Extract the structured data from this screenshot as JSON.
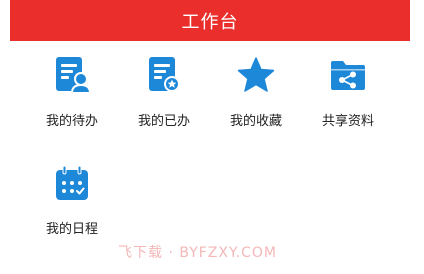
{
  "header": {
    "title": "工作台"
  },
  "tiles": [
    {
      "label": "我的待办",
      "icon": "pending-doc-user-icon"
    },
    {
      "label": "我的已办",
      "icon": "done-doc-star-icon"
    },
    {
      "label": "我的收藏",
      "icon": "star-icon"
    },
    {
      "label": "共享资料",
      "icon": "shared-folder-icon"
    },
    {
      "label": "我的日程",
      "icon": "calendar-icon"
    }
  ],
  "watermark": "飞下载 · BYFZXY.COM",
  "colors": {
    "header": "#ea2e2b",
    "icon_blue": "#1e88d8",
    "label_text": "#222222",
    "watermark": "#f3b7b7"
  }
}
